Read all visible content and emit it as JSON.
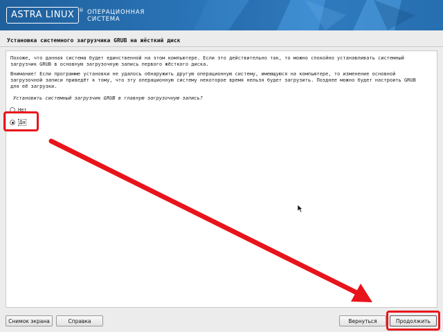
{
  "header": {
    "logo_text": "ASTRA LINUX",
    "logo_mark": "®",
    "os_label_line1": "ОПЕРАЦИОННАЯ",
    "os_label_line2": "СИСТЕМА",
    "colors": {
      "banner": "#2a75b8"
    }
  },
  "page": {
    "title": "Установка системного загрузчика GRUB на жёсткий диск"
  },
  "content": {
    "paragraph1": "Похоже, что данная система будет единственной на этом компьютере. Если это действительно так, то можно спокойно устанавливать системный\nзагрузчик GRUB в основную загрузочную запись первого жёсткого диска.",
    "paragraph2": "Внимание! Если программе установки не удалось обнаружить другую операционную систему, имеющуюся на компьютере, то изменение основной\nзагрузочной записи приведёт к тому, что эту операционную систему некоторое время нельзя будет загрузить. Позднее можно будет настроить GRUB\nдля её загрузки.",
    "question": "Установить системный загрузчик GRUB в главную загрузочную запись?",
    "options": [
      {
        "label": "Нет",
        "selected": false
      },
      {
        "label": "Да",
        "selected": true
      }
    ]
  },
  "footer": {
    "screenshot_label": "Снимок экрана",
    "help_label": "Справка",
    "back_label": "Вернуться",
    "continue_label": "Продолжить"
  },
  "annotations": {
    "highlight_color": "#e8141b",
    "icons": [
      "mouse-pointer-icon",
      "annotation-arrow"
    ]
  }
}
